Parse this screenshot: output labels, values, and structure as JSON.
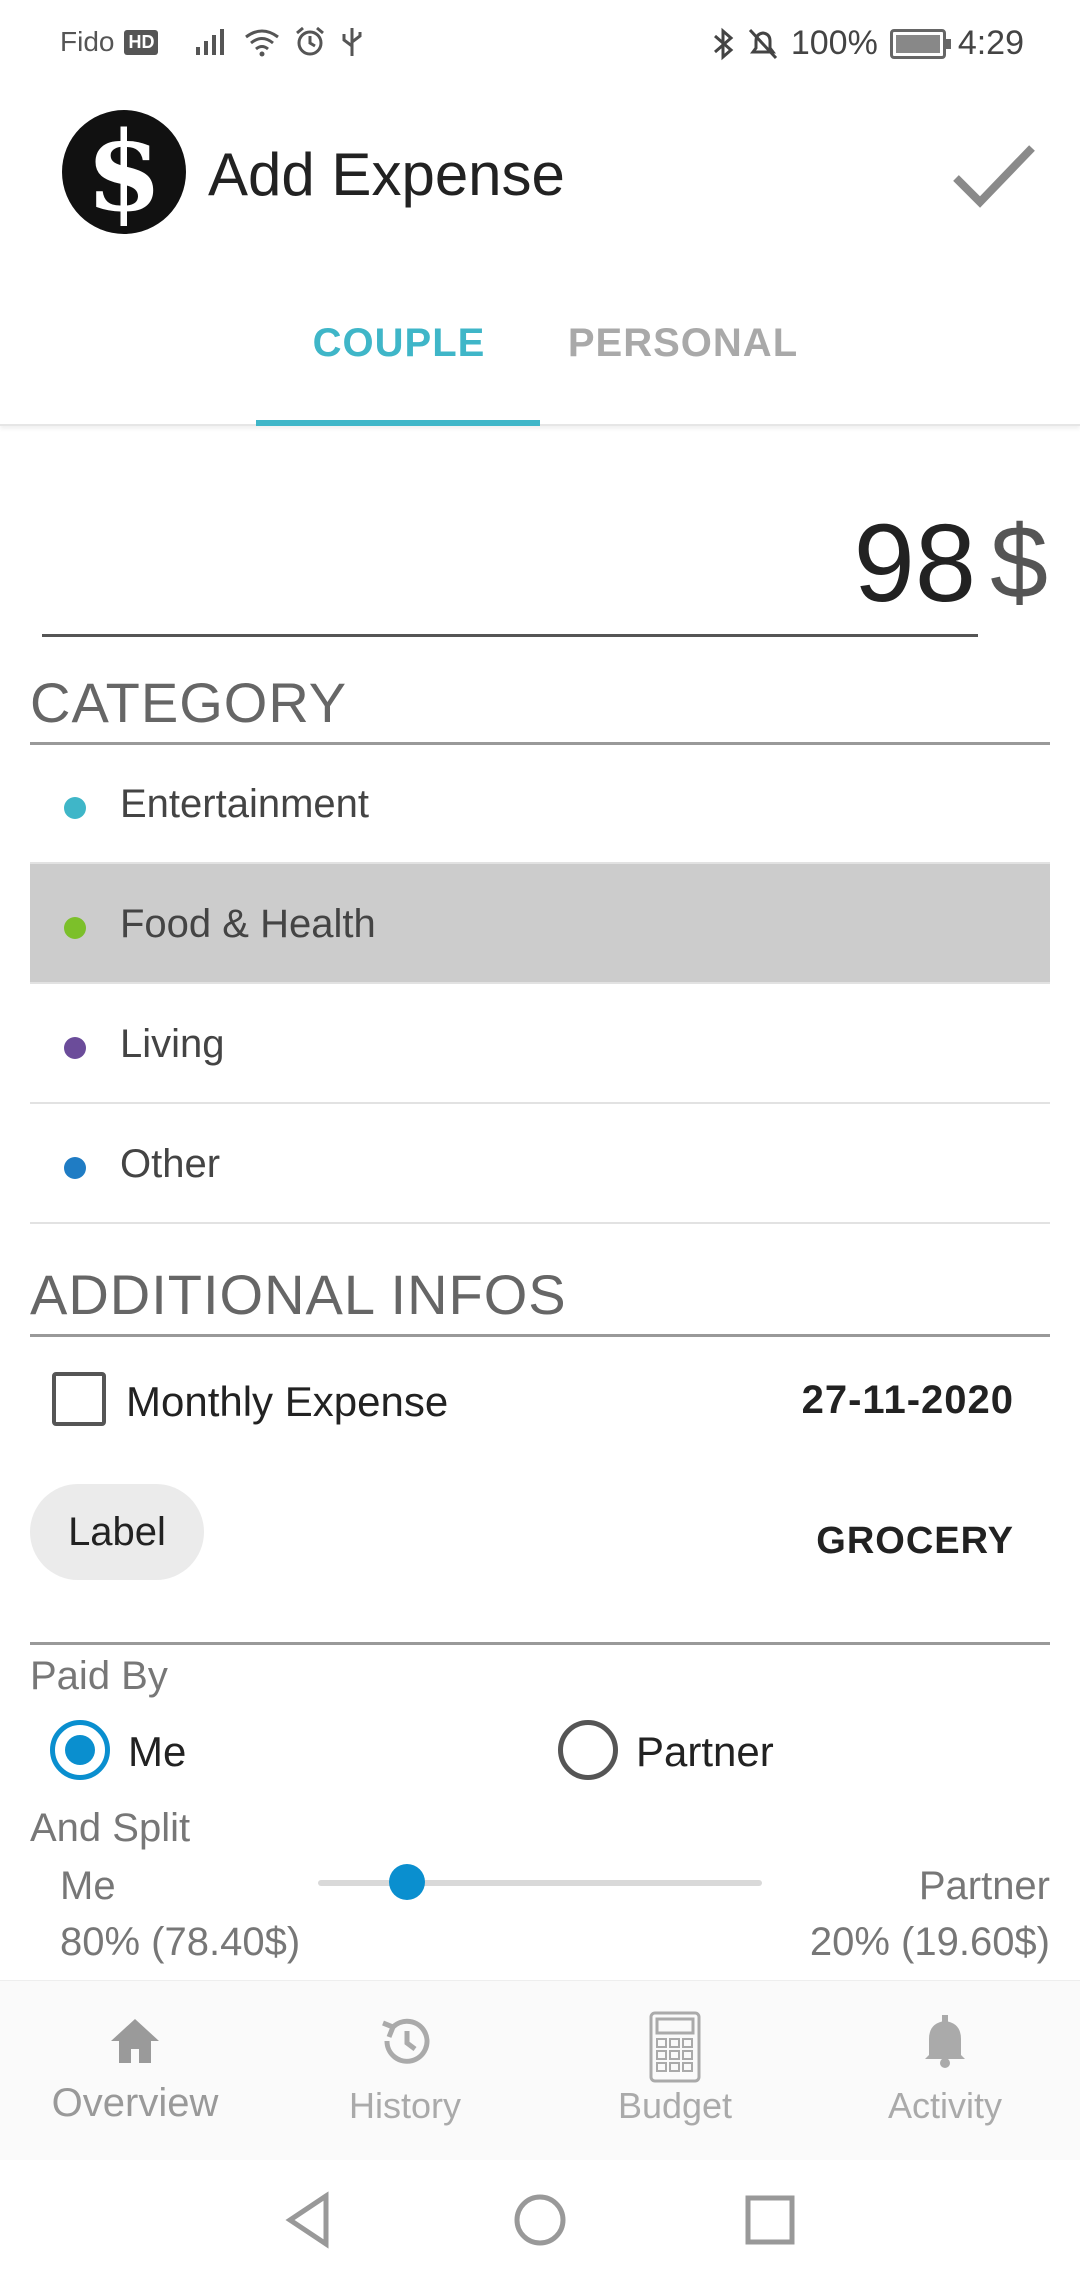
{
  "status_bar": {
    "carrier": "Fido",
    "hd_badge": "HD",
    "battery": "100%",
    "time": "4:29"
  },
  "header": {
    "title": "Add Expense",
    "logo_text": "$"
  },
  "tabs": [
    {
      "label": "COUPLE",
      "active": true
    },
    {
      "label": "PERSONAL",
      "active": false
    }
  ],
  "amount": {
    "value": "98",
    "currency": "$"
  },
  "category": {
    "heading": "CATEGORY",
    "items": [
      {
        "label": "Entertainment",
        "color": "#3fb6c8",
        "selected": false
      },
      {
        "label": "Food & Health",
        "color": "#7cc02a",
        "selected": true
      },
      {
        "label": "Living",
        "color": "#6b4c9a",
        "selected": false
      },
      {
        "label": "Other",
        "color": "#1f7cc4",
        "selected": false
      }
    ]
  },
  "additional": {
    "heading": "ADDITIONAL INFOS",
    "monthly_label": "Monthly Expense",
    "monthly_checked": false,
    "date": "27-11-2020",
    "label_chip": "Label",
    "label_value": "GROCERY"
  },
  "paid_by": {
    "heading": "Paid By",
    "options": [
      {
        "label": "Me",
        "selected": true
      },
      {
        "label": "Partner",
        "selected": false
      }
    ]
  },
  "split": {
    "heading": "And Split",
    "me_label": "Me",
    "me_value": "80% (78.40$)",
    "partner_label": "Partner",
    "partner_value": "20% (19.60$)",
    "me_fraction": 0.8
  },
  "bottom_nav": [
    {
      "label": "Overview",
      "icon": "home-icon",
      "active": true
    },
    {
      "label": "History",
      "icon": "history-icon",
      "active": false
    },
    {
      "label": "Budget",
      "icon": "calculator-icon",
      "active": false
    },
    {
      "label": "Activity",
      "icon": "bell-icon",
      "active": false
    }
  ],
  "colors": {
    "accent": "#3fb6c8",
    "radio_blue": "#0a8fcf",
    "selected_row": "#cccccc"
  }
}
